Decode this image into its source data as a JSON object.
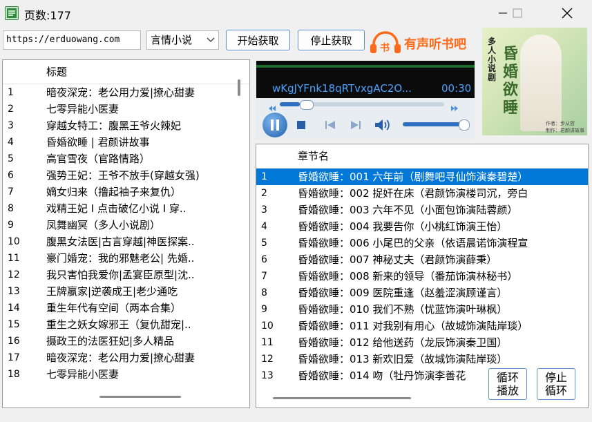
{
  "window": {
    "title": "页数:177"
  },
  "toolbar": {
    "url": "https://erduowang.com",
    "category": "言情小说",
    "start_label": "开始获取",
    "stop_label": "停止获取",
    "brand": "有声听书吧",
    "brand_glyph": "书"
  },
  "left_list": {
    "header": "标题",
    "rows": [
      {
        "n": "1",
        "t": "暗夜深宠：老公用力爱|撩心甜妻"
      },
      {
        "n": "2",
        "t": "七零异能小医妻"
      },
      {
        "n": "3",
        "t": "穿越女特工：腹黑王爷火辣妃"
      },
      {
        "n": "4",
        "t": "昏婚欲睡 | 君颜讲故事"
      },
      {
        "n": "5",
        "t": "高官雪夜（官路情路）"
      },
      {
        "n": "6",
        "t": "强势王妃：王爷不放手(穿越女强)"
      },
      {
        "n": "7",
        "t": "嫡女归来（撸起袖子来复仇）"
      },
      {
        "n": "8",
        "t": "戏精王妃 I 点击破亿小说 I 穿.."
      },
      {
        "n": "9",
        "t": "凤舞幽冥（多人小说剧）"
      },
      {
        "n": "10",
        "t": "腹黑女法医|古言穿越|神医探案.."
      },
      {
        "n": "11",
        "t": "豪门婚宠：我的邪魅老公| 先婚.."
      },
      {
        "n": "12",
        "t": "我只害怕我爱你|孟宴臣原型|沈.."
      },
      {
        "n": "13",
        "t": "王牌嬴家|逆袭成王|老少通吃"
      },
      {
        "n": "14",
        "t": "重生年代有空间（两本合集）"
      },
      {
        "n": "15",
        "t": "重生之妖女嫁邪王（复仇甜宠|.."
      },
      {
        "n": "16",
        "t": "摄政王的法医狂妃|多人精品"
      },
      {
        "n": "17",
        "t": "暗夜深宠：老公用力爱|撩心甜妻"
      },
      {
        "n": "18",
        "t": "七零异能小医妻"
      }
    ]
  },
  "player": {
    "track": "wKgJYFnk18qRTvxgAC2O...",
    "time": "00:30",
    "progress": 0.12,
    "volume": 0.95
  },
  "cover": {
    "series": "多人小说剧",
    "title": "昏婚欲睡",
    "author": "作者：步从容",
    "maker": "制作：君颜讲故事"
  },
  "right_list": {
    "header": "章节名",
    "rows": [
      {
        "n": "1",
        "t": "昏婚欲睡：001 六年前（剧舞吧寻仙饰演秦碧楚）"
      },
      {
        "n": "2",
        "t": "昏婚欲睡：002 捉奸在床（君颜饰演楼司沉，旁白"
      },
      {
        "n": "3",
        "t": "昏婚欲睡：003 六年不见（小面包饰演陆蓉颜）"
      },
      {
        "n": "4",
        "t": "昏婚欲睡：004 我要告你（小桃红饰演王怡）"
      },
      {
        "n": "5",
        "t": "昏婚欲睡：006 小尾巴的父亲（依语晨诺饰演程宣"
      },
      {
        "n": "6",
        "t": "昏婚欲睡：007 神秘丈夫（君颜饰演薛秉）"
      },
      {
        "n": "7",
        "t": "昏婚欲睡：008 新来的领导（番茄饰演林秘书）"
      },
      {
        "n": "8",
        "t": "昏婚欲睡：009 医院重逢（赵羞涩演顾谨言）"
      },
      {
        "n": "9",
        "t": "昏婚欲睡：010 我们不熟（忧蓝饰演叶琳枫）"
      },
      {
        "n": "10",
        "t": "昏婚欲睡：011 对我别有用心（故城饰演陆岸琰）"
      },
      {
        "n": "11",
        "t": "昏婚欲睡：012 给他送药（龙辰饰演秦卫国）"
      },
      {
        "n": "12",
        "t": "昏婚欲睡：013 新欢旧爱（故城饰演陆岸琰）"
      },
      {
        "n": "13",
        "t": "昏婚欲睡：014 吻（牡丹饰演李善花"
      }
    ]
  },
  "controls": {
    "loop_label": [
      "循环",
      "播放"
    ],
    "stop_loop_label": [
      "停止",
      "循环"
    ]
  },
  "colors": {
    "accent": "#0078d7",
    "brand": "#ff6a1a",
    "track_text": "#4aa3ff"
  }
}
